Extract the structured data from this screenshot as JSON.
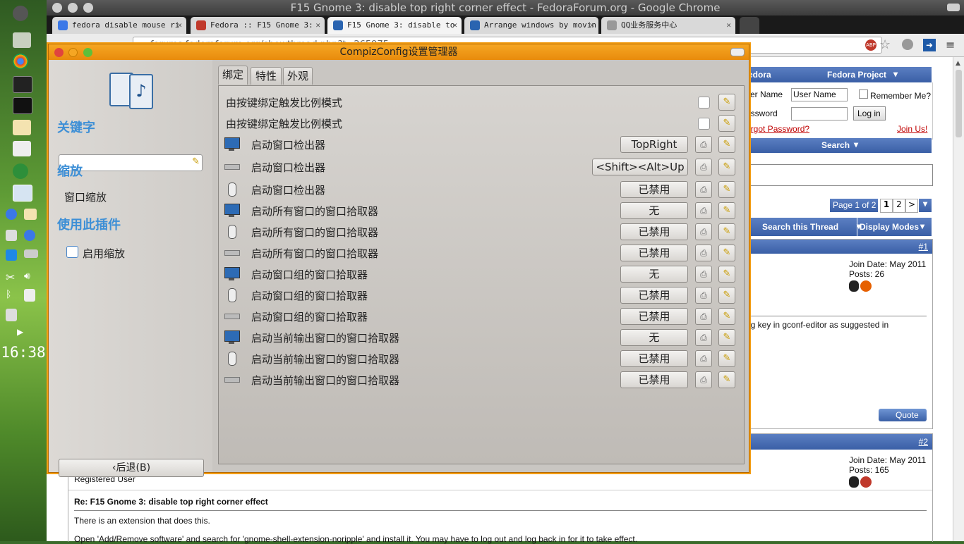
{
  "dock": {
    "clock": "16:38"
  },
  "chrome": {
    "window_title": "F15 Gnome 3: disable top right corner effect - FedoraForum.org - Google Chrome",
    "tabs": [
      {
        "label": "fedora disable mouse ri",
        "fav": "#3b78e7"
      },
      {
        "label": "Fedora :: F15 Gnome 3: ",
        "fav": "#c0392b"
      },
      {
        "label": "F15 Gnome 3: disable to",
        "fav": "#2a64b0"
      },
      {
        "label": "Arrange windows by movin",
        "fav": "#2a64b0"
      },
      {
        "label": "QQ业务服务中心",
        "fav": "#999999"
      }
    ],
    "url": "forums.fedoraforum.org/showthread.php?t=265975",
    "abp": "ABP"
  },
  "forum": {
    "nav_left": "edora",
    "nav_right": "Fedora Project",
    "user_label": "ser Name",
    "user_value": "User Name",
    "remember": "Remember Me?",
    "pass_label": "assword",
    "login": "Log in",
    "forgot": "orgot Password?",
    "join": "Join Us!",
    "search": "Search",
    "page_of": "Page 1 of 2",
    "pages": [
      "1",
      "2",
      ">"
    ],
    "search_thread": "Search this Thread",
    "display_modes": "Display Modes",
    "post1": {
      "num": "#1",
      "join": "Join Date: May 2011",
      "posts": "Posts: 26",
      "text": "ng key in gconf-editor as suggested in",
      "quote": "Quote"
    },
    "post2": {
      "num": "#2",
      "join": "Join Date: May 2011",
      "posts": "Posts: 165",
      "role": "Registered User",
      "title": "Re: F15 Gnome 3: disable top right corner effect",
      "line1": "There is an extension that does this.",
      "line2": "Open 'Add/Remove software' and search for 'gnome-shell-extension-noripple' and install it. You may have to log out and log back in for it to take effect."
    }
  },
  "dialog": {
    "title": "CompizConfig设置管理器",
    "sidebar": {
      "keyword_heading": "关键字",
      "category_heading": "缩放",
      "category_item": "窗口缩放",
      "use_plugin_heading": "使用此插件",
      "enable_label": "启用缩放",
      "back_label": "后退(B)"
    },
    "tabs": [
      "绑定",
      "特性",
      "外观"
    ],
    "rows": [
      {
        "icon": "none",
        "label": "由按键绑定触发比例模式",
        "type": "check"
      },
      {
        "icon": "none",
        "label": "由按键绑定触发比例模式",
        "type": "check"
      },
      {
        "icon": "monitor-icon",
        "label": "启动窗口检出器",
        "value": "TopRight"
      },
      {
        "icon": "keyboard-icon",
        "label": "启动窗口检出器",
        "value": "<Shift><Alt>Up"
      },
      {
        "icon": "mouse-icon",
        "label": "启动窗口检出器",
        "value": "已禁用"
      },
      {
        "icon": "monitor-icon",
        "label": "启动所有窗口的窗口拾取器",
        "value": "无"
      },
      {
        "icon": "mouse-icon",
        "label": "启动所有窗口的窗口拾取器",
        "value": "已禁用"
      },
      {
        "icon": "keyboard-icon",
        "label": "启动所有窗口的窗口拾取器",
        "value": "已禁用"
      },
      {
        "icon": "monitor-icon",
        "label": "启动窗口组的窗口拾取器",
        "value": "无"
      },
      {
        "icon": "mouse-icon",
        "label": "启动窗口组的窗口拾取器",
        "value": "已禁用"
      },
      {
        "icon": "keyboard-icon",
        "label": "启动窗口组的窗口拾取器",
        "value": "已禁用"
      },
      {
        "icon": "monitor-icon",
        "label": "启动当前输出窗口的窗口拾取器",
        "value": "无"
      },
      {
        "icon": "mouse-icon",
        "label": "启动当前输出窗口的窗口拾取器",
        "value": "已禁用"
      },
      {
        "icon": "keyboard-icon",
        "label": "启动当前输出窗口的窗口拾取器",
        "value": "已禁用"
      }
    ]
  }
}
